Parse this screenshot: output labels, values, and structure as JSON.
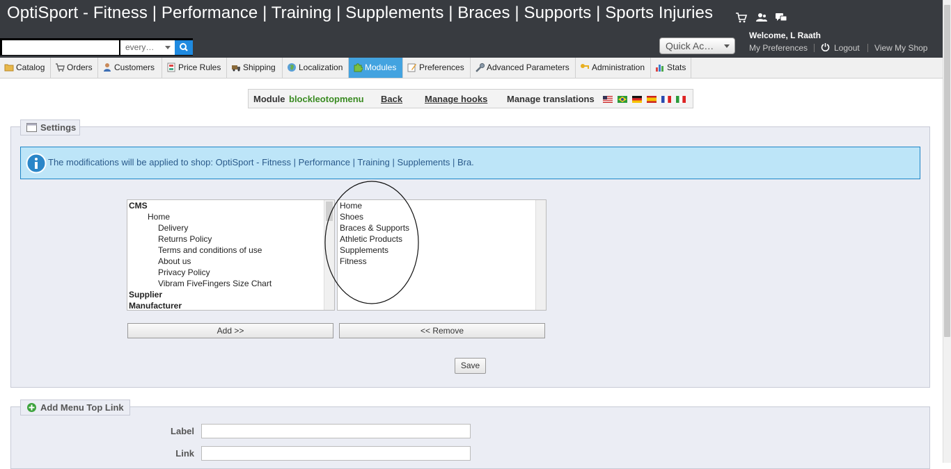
{
  "header": {
    "shop_title": "OptiSport - Fitness | Performance | Training | Supplements | Braces | Supports | Sports Injuries",
    "search": {
      "value": "",
      "scope": "every…"
    },
    "quick_access": "Quick Ac…",
    "welcome_label": "Welcome,",
    "welcome_user": "L Raath",
    "my_preferences": "My Preferences",
    "logout": "Logout",
    "view_my_shop": "View My Shop"
  },
  "tabs": [
    {
      "label": "Catalog"
    },
    {
      "label": "Orders"
    },
    {
      "label": "Customers"
    },
    {
      "label": "Price Rules"
    },
    {
      "label": "Shipping"
    },
    {
      "label": "Localization"
    },
    {
      "label": "Modules"
    },
    {
      "label": "Preferences"
    },
    {
      "label": "Advanced Parameters"
    },
    {
      "label": "Administration"
    },
    {
      "label": "Stats"
    }
  ],
  "active_tab": "Modules",
  "module_bar": {
    "module_label": "Module",
    "module_name": "blockleotopmenu",
    "back": "Back",
    "manage_hooks": "Manage hooks",
    "manage_translations": "Manage translations"
  },
  "settings": {
    "legend": "Settings",
    "info": "The modifications will be applied to shop: OptiSport - Fitness | Performance | Training | Supplements | Bra.",
    "available_items": [
      {
        "label": "CMS"
      },
      {
        "label": "Home"
      },
      {
        "label": "Delivery"
      },
      {
        "label": "Returns Policy"
      },
      {
        "label": "Terms and conditions of use"
      },
      {
        "label": "About us"
      },
      {
        "label": "Privacy Policy"
      },
      {
        "label": "Vibram FiveFingers Size Chart"
      },
      {
        "label": "Supplier"
      },
      {
        "label": "Manufacturer"
      }
    ],
    "selected_items": [
      "Home",
      "Shoes",
      "Braces & Supports",
      "Athletic Products",
      "Supplements",
      "Fitness"
    ],
    "add_button": "Add >>",
    "remove_button": "<< Remove",
    "save_button": "Save"
  },
  "add_link": {
    "legend": "Add Menu Top Link",
    "label_field": "Label",
    "link_field": "Link",
    "label_value": "",
    "link_value": ""
  },
  "colors": {
    "header_bg": "#383b40",
    "active_tab": "#43a3e0",
    "module_name": "#3a8b22",
    "info_bg": "#bde5f8",
    "fieldset_bg": "#ebedf4"
  }
}
